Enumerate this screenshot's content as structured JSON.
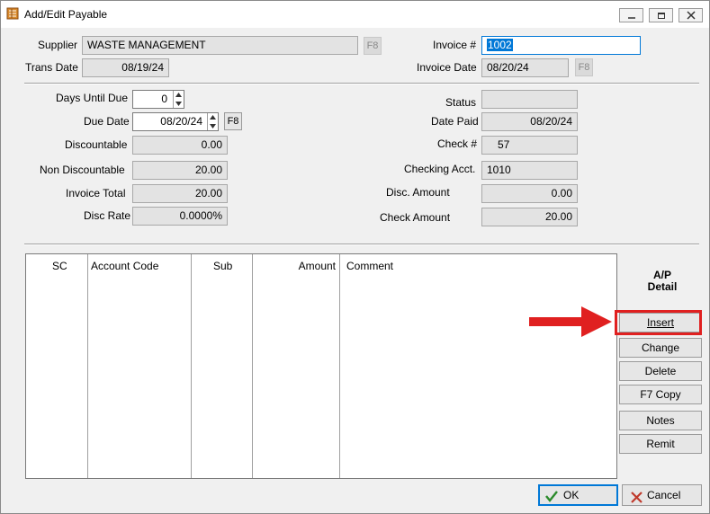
{
  "window": {
    "title": "Add/Edit Payable",
    "icons": [
      "app-ledger-icon",
      "minimize-icon",
      "restore-icon",
      "close-icon"
    ]
  },
  "header": {
    "supplier_label": "Supplier",
    "supplier_value": "WASTE MANAGEMENT",
    "trans_date_label": "Trans Date",
    "trans_date_value": "08/19/24",
    "invoice_no_label": "Invoice #",
    "invoice_no_value": "1002",
    "invoice_date_label": "Invoice Date",
    "invoice_date_value": "08/20/24",
    "f8": "F8"
  },
  "left": {
    "days_until_due_label": "Days Until Due",
    "days_until_due_value": "0",
    "due_date_label": "Due Date",
    "due_date_value": "08/20/24",
    "discountable_label": "Discountable",
    "discountable_value": "0.00",
    "non_discountable_label": "Non Discountable",
    "non_discountable_value": "20.00",
    "invoice_total_label": "Invoice Total",
    "invoice_total_value": "20.00",
    "disc_rate_label": "Disc Rate",
    "disc_rate_value": "0.0000%"
  },
  "right": {
    "status_label": "Status",
    "status_value": "",
    "date_paid_label": "Date Paid",
    "date_paid_value": "08/20/24",
    "check_no_label": "Check #",
    "check_no_value": "57",
    "checking_acct_label": "Checking Acct.",
    "checking_acct_value": "1010",
    "disc_amount_label": "Disc. Amount",
    "disc_amount_value": "0.00",
    "check_amount_label": "Check Amount",
    "check_amount_value": "20.00"
  },
  "grid": {
    "columns": [
      "SC",
      "Account Code",
      "Sub",
      "Amount",
      "Comment"
    ],
    "rows": []
  },
  "detail": {
    "heading_line1": "A/P",
    "heading_line2": "Detail",
    "insert": "Insert",
    "change": "Change",
    "delete": "Delete",
    "copy": "F7 Copy",
    "notes": "Notes",
    "remit": "Remit"
  },
  "footer": {
    "ok": "OK",
    "cancel": "Cancel"
  },
  "colors": {
    "annotation_red": "#e02020",
    "selection_blue": "#0078d7",
    "ok_check_green": "#2a8a2a",
    "cancel_x_red": "#c0392b"
  }
}
